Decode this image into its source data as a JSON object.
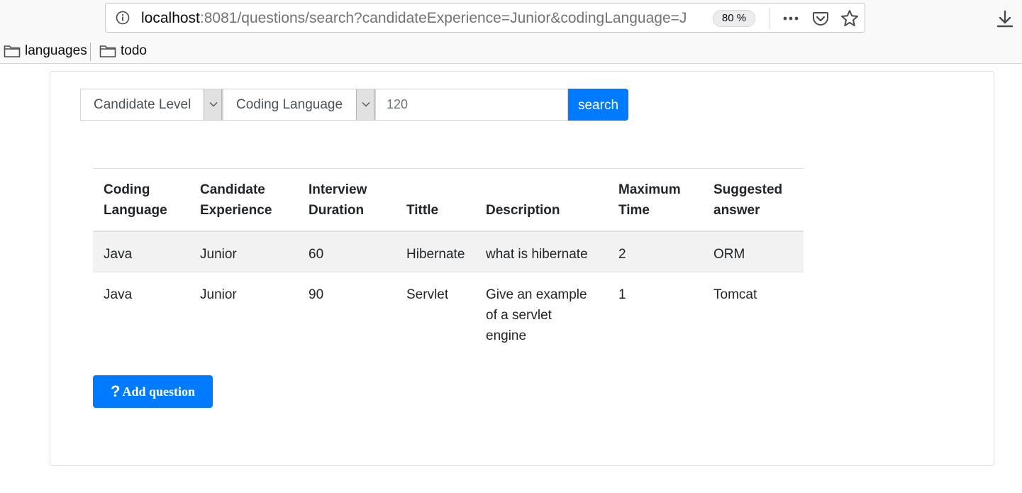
{
  "browser": {
    "url_host": "localhost",
    "url_rest": ":8081/questions/search?candidateExperience=Junior&codingLanguage=J",
    "zoom": "80 %",
    "icons": [
      "info-icon",
      "more-icon",
      "pocket-icon",
      "star-icon",
      "download-icon"
    ]
  },
  "bookmarks": [
    {
      "label": "languages",
      "icon": "folder-icon"
    },
    {
      "label": "todo",
      "icon": "folder-icon"
    }
  ],
  "filters": {
    "candidate_level": "Candidate Level",
    "coding_language": "Coding Language",
    "duration_value": "120",
    "search_label": "search"
  },
  "table": {
    "headers": [
      [
        "Coding",
        "Language"
      ],
      [
        "Candidate",
        "Experience"
      ],
      [
        "Interview",
        "Duration"
      ],
      [
        "",
        "Tittle"
      ],
      [
        "",
        "Description"
      ],
      [
        "Maximum",
        "Time"
      ],
      [
        "Suggested",
        "answer"
      ]
    ],
    "rows": [
      [
        "Java",
        "Junior",
        "60",
        "Hibernate",
        "what is hibernate",
        "2",
        "ORM"
      ],
      [
        "Java",
        "Junior",
        "90",
        "Servlet",
        "Give an example of a servlet engine",
        "1",
        "Tomcat"
      ]
    ]
  },
  "add_question": {
    "icon": "question-mark-icon",
    "label": "Add question"
  },
  "colors": {
    "primary": "#007bff",
    "striped_row": "#f2f2f2"
  }
}
